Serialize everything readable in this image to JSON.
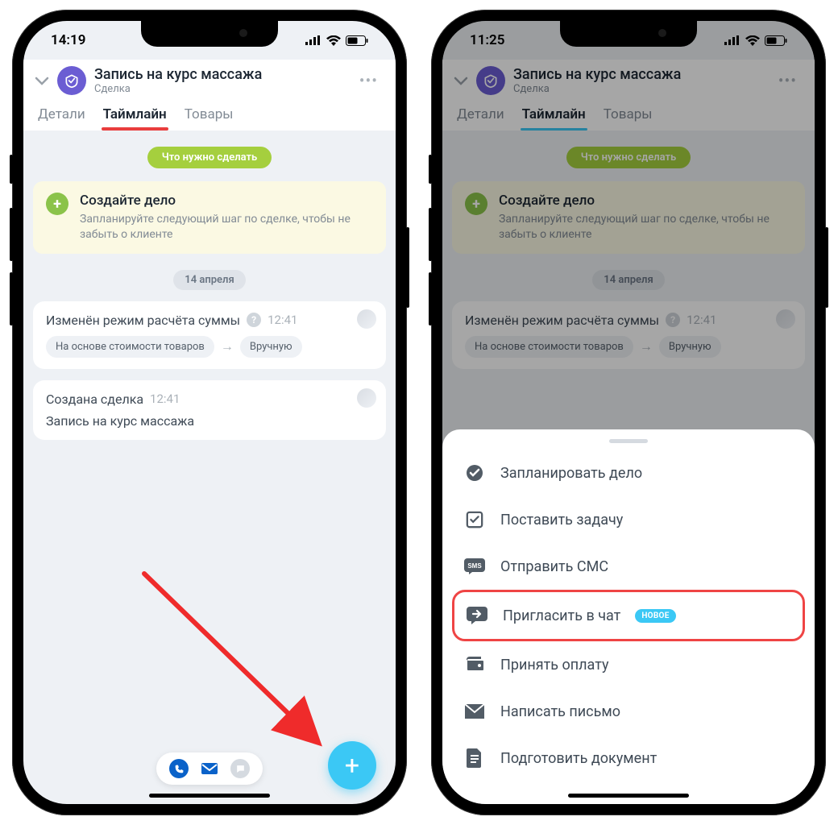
{
  "phone1": {
    "time": "14:19",
    "title": "Запись на курс массажа",
    "subtitle": "Сделка",
    "tabs": [
      "Детали",
      "Таймлайн",
      "Товары"
    ],
    "todo_pill": "Что нужно сделать",
    "create": {
      "title": "Создайте дело",
      "desc": "Запланируйте следующий шаг по сделке, чтобы не забыть о клиенте"
    },
    "date": "14 апреля",
    "event1": {
      "title": "Изменён режим расчёта суммы",
      "time": "12:41",
      "chip_from": "На основе стоимости товаров",
      "chip_to": "Вручную"
    },
    "event2": {
      "title": "Создана сделка",
      "time": "12:41",
      "body": "Запись на курс массажа"
    }
  },
  "phone2": {
    "time": "11:25",
    "title": "Запись на курс массажа",
    "subtitle": "Сделка",
    "tabs": [
      "Детали",
      "Таймлайн",
      "Товары"
    ],
    "todo_pill": "Что нужно сделать",
    "create": {
      "title": "Создайте дело",
      "desc": "Запланируйте следующий шаг по сделке, чтобы не забыть о клиенте"
    },
    "date": "14 апреля",
    "event1": {
      "title": "Изменён режим расчёта суммы",
      "time": "12:41",
      "chip_from": "На основе стоимости товаров",
      "chip_to": "Вручную"
    },
    "sheet": {
      "items": [
        "Запланировать дело",
        "Поставить задачу",
        "Отправить СМС",
        "Пригласить в чат",
        "Принять оплату",
        "Написать письмо",
        "Подготовить документ"
      ],
      "badge": "НОВОЕ"
    }
  }
}
